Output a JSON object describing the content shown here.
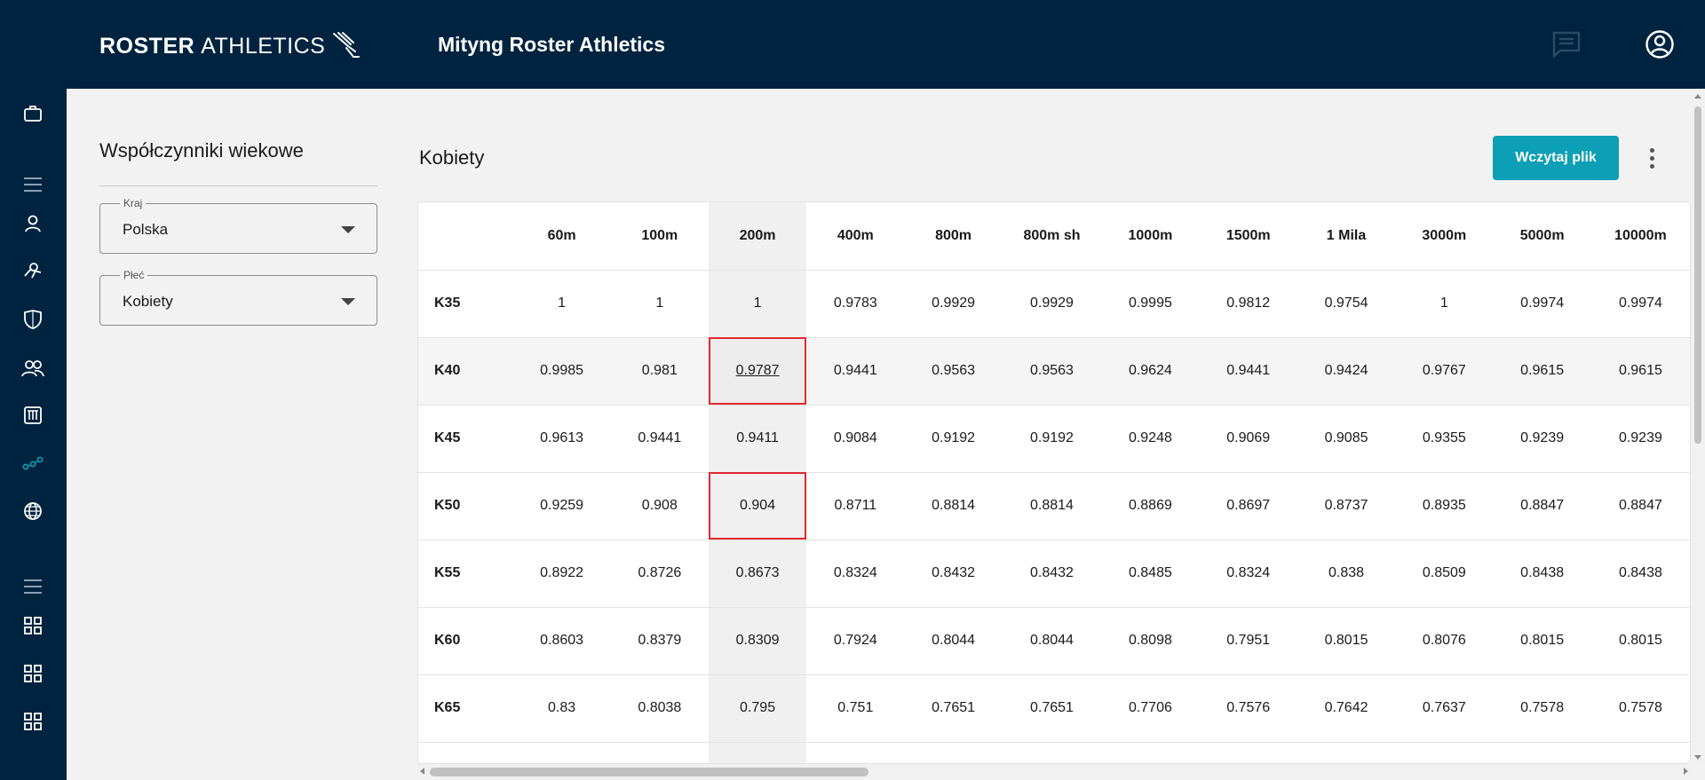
{
  "brand": {
    "bold": "ROSTER",
    "thin": "ATHLETICS"
  },
  "header": {
    "title": "Mityng Roster Athletics",
    "chat_icon": "chat-icon",
    "account_icon": "account-icon"
  },
  "colors": {
    "navy": "#00233f",
    "accent": "#0d9fb5",
    "active_nav": "#0d9fb5",
    "highlight_border": "#e0292f"
  },
  "sidebar": {
    "items": [
      {
        "icon": "briefcase-icon"
      },
      {
        "icon": "menu-icon"
      },
      {
        "icon": "person-icon"
      },
      {
        "icon": "athlete-icon"
      },
      {
        "icon": "shield-icon"
      },
      {
        "icon": "people-icon"
      },
      {
        "icon": "scoreboard-icon"
      },
      {
        "icon": "age-factors-icon",
        "active": true
      },
      {
        "icon": "globe-icon"
      },
      {
        "icon": "menu-icon"
      },
      {
        "icon": "grid-icon"
      },
      {
        "icon": "grid-icon"
      },
      {
        "icon": "grid-icon"
      }
    ]
  },
  "panel": {
    "title": "Współczynniki wiekowe",
    "country": {
      "label": "Kraj",
      "value": "Polska"
    },
    "gender": {
      "label": "Płeć",
      "value": "Kobiety"
    }
  },
  "main": {
    "section_title": "Kobiety",
    "load_button": "Wczytaj plik",
    "more_icon": "more-vert-icon"
  },
  "table": {
    "columns": [
      "60m",
      "100m",
      "200m",
      "400m",
      "800m",
      "800m sh",
      "1000m",
      "1500m",
      "1 Mila",
      "3000m",
      "5000m",
      "10000m"
    ],
    "rows": [
      {
        "label": "K35",
        "values": [
          "1",
          "1",
          "1",
          "0.9783",
          "0.9929",
          "0.9929",
          "0.9995",
          "0.9812",
          "0.9754",
          "1",
          "0.9974",
          "0.9974"
        ]
      },
      {
        "label": "K40",
        "values": [
          "0.9985",
          "0.981",
          "0.9787",
          "0.9441",
          "0.9563",
          "0.9563",
          "0.9624",
          "0.9441",
          "0.9424",
          "0.9767",
          "0.9615",
          "0.9615"
        ]
      },
      {
        "label": "K45",
        "values": [
          "0.9613",
          "0.9441",
          "0.9411",
          "0.9084",
          "0.9192",
          "0.9192",
          "0.9248",
          "0.9069",
          "0.9085",
          "0.9355",
          "0.9239",
          "0.9239"
        ]
      },
      {
        "label": "K50",
        "values": [
          "0.9259",
          "0.908",
          "0.904",
          "0.8711",
          "0.8814",
          "0.8814",
          "0.8869",
          "0.8697",
          "0.8737",
          "0.8935",
          "0.8847",
          "0.8847"
        ]
      },
      {
        "label": "K55",
        "values": [
          "0.8922",
          "0.8726",
          "0.8673",
          "0.8324",
          "0.8432",
          "0.8432",
          "0.8485",
          "0.8324",
          "0.838",
          "0.8509",
          "0.8438",
          "0.8438"
        ]
      },
      {
        "label": "K60",
        "values": [
          "0.8603",
          "0.8379",
          "0.8309",
          "0.7924",
          "0.8044",
          "0.8044",
          "0.8098",
          "0.7951",
          "0.8015",
          "0.8076",
          "0.8015",
          "0.8015"
        ]
      },
      {
        "label": "K65",
        "values": [
          "0.83",
          "0.8038",
          "0.795",
          "0.751",
          "0.7651",
          "0.7651",
          "0.7706",
          "0.7576",
          "0.7642",
          "0.7637",
          "0.7578",
          "0.7578"
        ]
      },
      {
        "label": "",
        "values": [
          "",
          "",
          "",
          "",
          "",
          "",
          "",
          "",
          "",
          "",
          "",
          ""
        ]
      }
    ],
    "highlight_column": 2,
    "highlight_row": 1,
    "boxed_cells": [
      [
        1,
        2
      ],
      [
        3,
        2
      ]
    ],
    "underlined_cells": [
      [
        1,
        2
      ]
    ]
  }
}
